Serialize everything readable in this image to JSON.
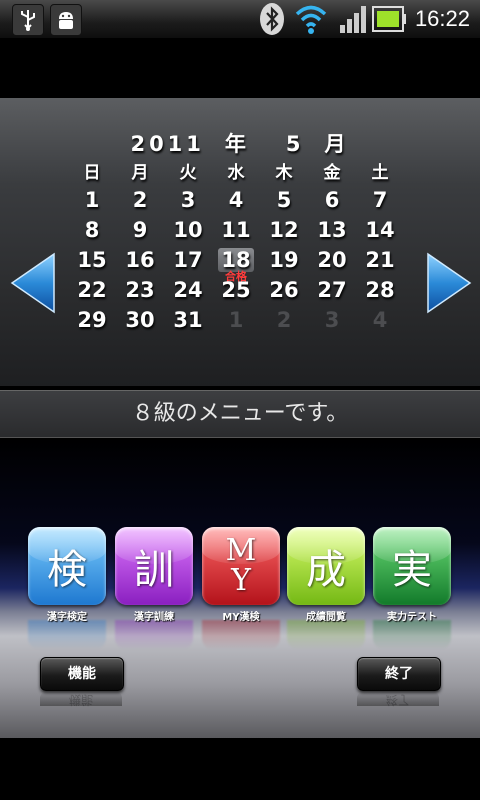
{
  "status_bar": {
    "time": "16:22",
    "icons": [
      "usb-icon",
      "android-debug-icon",
      "bluetooth-icon",
      "wifi-icon",
      "signal-icon",
      "battery-icon"
    ]
  },
  "calendar": {
    "year": "2011",
    "year_unit": "年",
    "month": "5",
    "month_unit": "月",
    "weekdays": [
      "日",
      "月",
      "火",
      "水",
      "木",
      "金",
      "土"
    ],
    "weeks": [
      [
        "1",
        "2",
        "3",
        "4",
        "5",
        "6",
        "7"
      ],
      [
        "8",
        "9",
        "10",
        "11",
        "12",
        "13",
        "14"
      ],
      [
        "15",
        "16",
        "17",
        "18",
        "19",
        "20",
        "21"
      ],
      [
        "22",
        "23",
        "24",
        "25",
        "26",
        "27",
        "28"
      ],
      [
        "29",
        "30",
        "31",
        "1",
        "2",
        "3",
        "4"
      ]
    ],
    "dimmed_last_row_from_index": 3,
    "today": "18",
    "today_badge": "合格",
    "prev_icon": "left-arrow-icon",
    "next_icon": "right-arrow-icon",
    "arrow_color": "#2b8ad8"
  },
  "message": "８級のメニューです。",
  "menu": {
    "tiles": [
      {
        "glyph": "検",
        "label": "漢字検定",
        "color_top": "#7fd0ff",
        "color_bottom": "#1e78d0"
      },
      {
        "glyph": "訓",
        "label": "漢字訓練",
        "color_top": "#e07bff",
        "color_bottom": "#8a1fc0"
      },
      {
        "glyph": "MY",
        "label": "MY漢検",
        "color_top": "#ff6a6a",
        "color_bottom": "#b3121a"
      },
      {
        "glyph": "成",
        "label": "成績閲覧",
        "color_top": "#dcff70",
        "color_bottom": "#74b814"
      },
      {
        "glyph": "実",
        "label": "実力テスト",
        "color_top": "#6fe07a",
        "color_bottom": "#127a2a"
      }
    ],
    "function_button": "機能",
    "exit_button": "終了"
  }
}
